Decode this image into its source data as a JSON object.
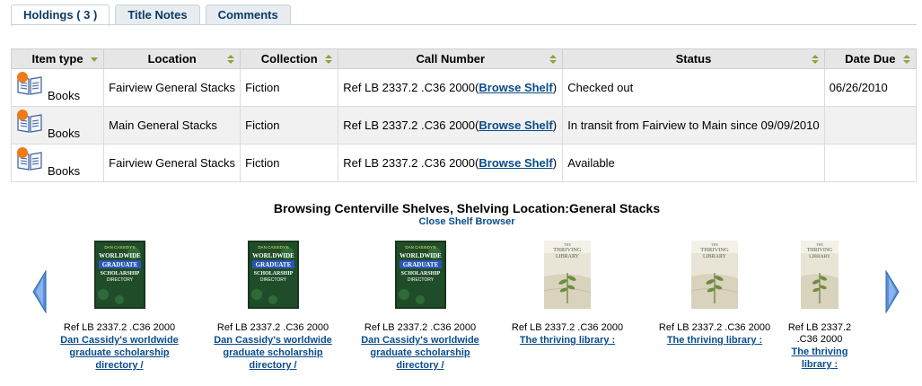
{
  "tabs": [
    {
      "label": "Holdings ( 3 )",
      "active": true
    },
    {
      "label": "Title Notes",
      "active": false
    },
    {
      "label": "Comments",
      "active": false
    }
  ],
  "holdings": {
    "headers": [
      "Item type",
      "Location",
      "Collection",
      "Call Number",
      "Status",
      "Date Due"
    ],
    "rows": [
      {
        "item_type": "Books",
        "location": "Fairview General Stacks",
        "collection": "Fiction",
        "call_number": "Ref LB 2337.2 .C36 2000",
        "paren_open": "(",
        "browse": "Browse Shelf",
        "paren_close": ")",
        "status": "Checked out",
        "date_due": "06/26/2010"
      },
      {
        "item_type": "Books",
        "location": "Main General Stacks",
        "collection": "Fiction",
        "call_number": "Ref LB 2337.2 .C36 2000",
        "paren_open": "(",
        "browse": "Browse Shelf",
        "paren_close": ")",
        "status": "In transit from Fairview to Main since 09/09/2010",
        "date_due": ""
      },
      {
        "item_type": "Books",
        "location": "Fairview General Stacks",
        "collection": "Fiction",
        "call_number": "Ref LB 2337.2 .C36 2000",
        "paren_open": "(",
        "browse": "Browse Shelf",
        "paren_close": ")",
        "status": "Available",
        "date_due": ""
      }
    ]
  },
  "shelf_browser": {
    "heading": "Browsing Centerville Shelves, Shelving Location:General Stacks",
    "close_label": "Close Shelf Browser",
    "items": [
      {
        "call_number": "Ref LB 2337.2 .C36 2000",
        "title_lines": [
          "Dan Cassidy's worldwide",
          "graduate scholarship",
          "directory /"
        ],
        "cover": "scholarship-directory-cover"
      },
      {
        "call_number": "Ref LB 2337.2 .C36 2000",
        "title_lines": [
          "Dan Cassidy's worldwide",
          "graduate scholarship",
          "directory /"
        ],
        "cover": "scholarship-directory-cover"
      },
      {
        "call_number": "Ref LB 2337.2 .C36 2000",
        "title_lines": [
          "Dan Cassidy's worldwide",
          "graduate scholarship",
          "directory /"
        ],
        "cover": "scholarship-directory-cover"
      },
      {
        "call_number": "Ref LB 2337.2 .C36 2000",
        "title_lines": [
          "The thriving library :"
        ],
        "cover": "thriving-library-cover"
      },
      {
        "call_number": "Ref LB 2337.2 .C36 2000",
        "title_lines": [
          "The thriving library :"
        ],
        "cover": "thriving-library-cover"
      },
      {
        "call_number_lines": [
          "Ref LB 2337.2",
          ".C36 2000"
        ],
        "title_lines": [
          "The thriving",
          "library :"
        ],
        "cover": "thriving-library-cover"
      }
    ],
    "cover_texts": {
      "scholarship": [
        "DAN CASSIDY'S",
        "WORLDWIDE",
        "GRADUATE",
        "SCHOLARSHIP",
        "DIRECTORY"
      ],
      "thriving": [
        "THE",
        "THRIVING",
        "LIBRARY"
      ]
    }
  },
  "icons": {
    "item_type": "book-new-icon",
    "sort": "sort-arrows-icon",
    "prev": "previous-arrow-icon",
    "next": "next-arrow-icon"
  },
  "colors": {
    "link": "#0a4c8a",
    "tab_text": "#0a3a66",
    "header_bg": "#e6e6e6",
    "alt_row_bg": "#f1f1f1",
    "arrow_blue": "#5a8fd6",
    "sort_green": "#8aa43c",
    "new_badge": "#f07a18"
  }
}
